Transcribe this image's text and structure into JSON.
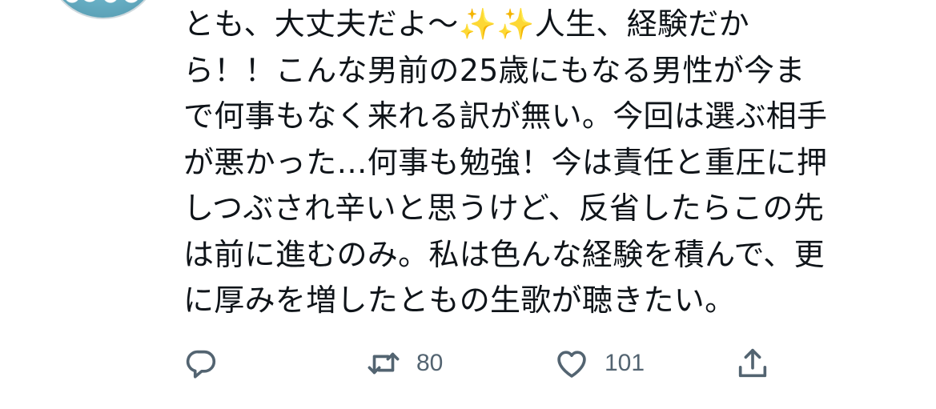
{
  "tweet": {
    "text_lines": [
      "とも、大丈夫だよ〜✨✨人生、経験だか",
      "ら！！こんな男前の25歳にもなる男性が今ま",
      "で何事もなく来れる訳が無い。今回は選ぶ相手",
      "が悪かった…何事も勉強！今は責任と重圧に押",
      "しつぶされ辛いと思うけど、反省したらこの先",
      "は前に進むのみ。私は色んな経験を積んで、更",
      "に厚みを増したともの生歌が聴きたい。"
    ]
  },
  "actions": {
    "reply": {
      "icon": "reply-icon",
      "count": ""
    },
    "retweet": {
      "icon": "retweet-icon",
      "count": "80"
    },
    "like": {
      "icon": "heart-icon",
      "count": "101"
    },
    "share": {
      "icon": "share-icon",
      "count": ""
    }
  },
  "colors": {
    "text": "#0f1419",
    "icon": "#536471",
    "background": "#ffffff"
  }
}
